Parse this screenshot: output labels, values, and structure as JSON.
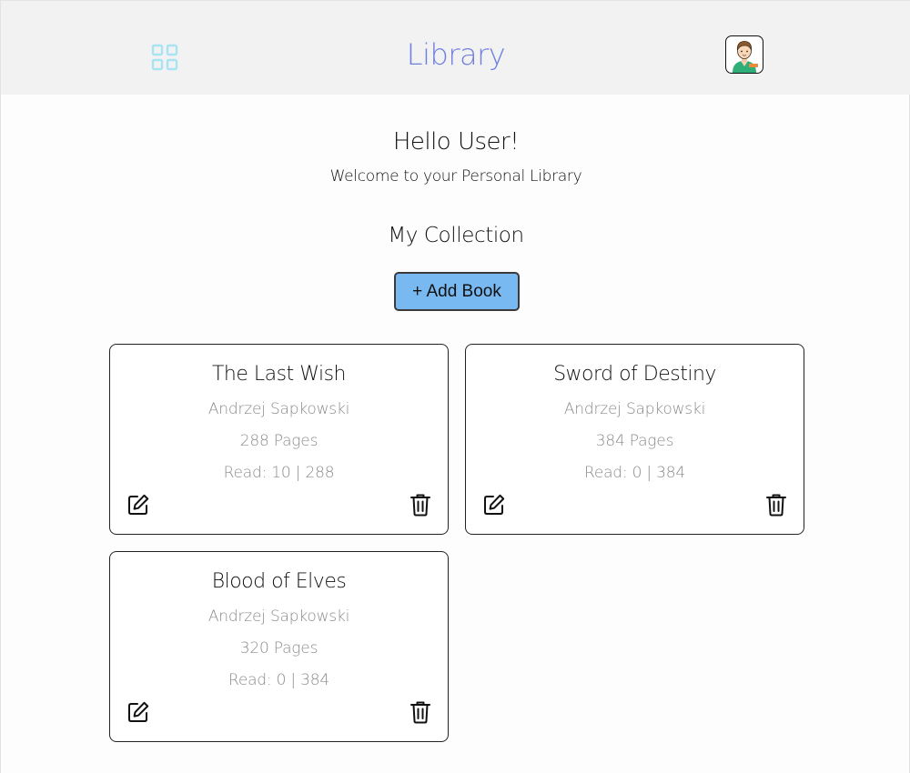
{
  "header": {
    "menu_icon": "grid-icon",
    "title": "Library",
    "avatar_icon": "user-avatar-icon",
    "title_color": "#6f7fde"
  },
  "greeting": {
    "title": "Hello User!",
    "subtitle": "Welcome to your Personal Library"
  },
  "collection": {
    "title": "My Collection",
    "add_button_label": "+ Add Book",
    "add_button_color": "#79b9f1",
    "books": [
      {
        "title": "The Last Wish",
        "author": "Andrzej Sapkowski",
        "pages": "288 Pages",
        "progress": "Read: 10 | 288"
      },
      {
        "title": "Sword of Destiny",
        "author": "Andrzej Sapkowski",
        "pages": "384 Pages",
        "progress": "Read: 0 | 384"
      },
      {
        "title": "Blood of Elves",
        "author": "Andrzej Sapkowski",
        "pages": "320 Pages",
        "progress": "Read: 0 | 384"
      }
    ],
    "edit_icon": "edit-icon",
    "delete_icon": "trash-icon"
  }
}
